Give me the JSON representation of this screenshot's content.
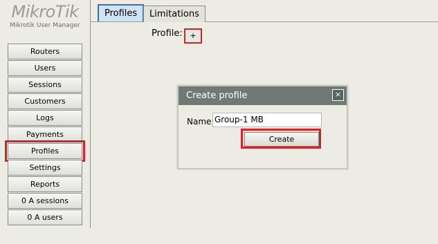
{
  "app": {
    "logo_main": "MikroTik",
    "logo_sub": "Mikrotik User Manager"
  },
  "sidebar": {
    "items": [
      {
        "label": "Routers"
      },
      {
        "label": "Users"
      },
      {
        "label": "Sessions"
      },
      {
        "label": "Customers"
      },
      {
        "label": "Logs"
      },
      {
        "label": "Payments"
      },
      {
        "label": "Profiles"
      },
      {
        "label": "Settings"
      },
      {
        "label": "Reports"
      },
      {
        "label": "0 A sessions"
      },
      {
        "label": "0 A users"
      }
    ]
  },
  "tabs": [
    {
      "label": "Profiles",
      "active": true
    },
    {
      "label": "Limitations",
      "active": false
    }
  ],
  "main": {
    "profile_label": "Profile:",
    "add_label": "+"
  },
  "dialog": {
    "title": "Create profile",
    "close_label": "×",
    "name_label": "Name:",
    "name_value": "Group-1 MB",
    "create_label": "Create"
  },
  "colors": {
    "highlight": "#d2232a",
    "dialog_header": "#6f7a74",
    "active_tab": "#cfe3f5"
  }
}
